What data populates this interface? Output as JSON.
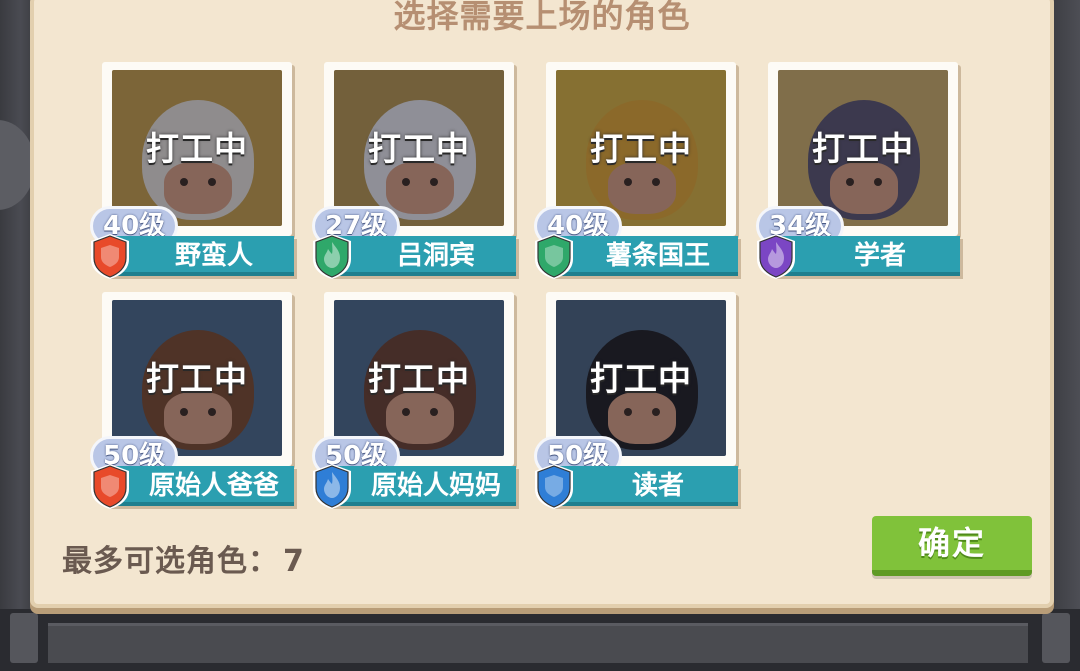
{
  "title": "选择需要上场的角色",
  "status_text": "打工中",
  "characters": [
    {
      "name": "野蛮人",
      "level": "40级",
      "badge_color": "#e84a2a",
      "badge_icon": "shield-icon",
      "bg": "#c9a14a",
      "hair": "#e9e4dc"
    },
    {
      "name": "吕洞宾",
      "level": "27级",
      "badge_color": "#2fa86a",
      "badge_icon": "flame-icon",
      "bg": "#b89850",
      "hair": "#e8e8ee"
    },
    {
      "name": "薯条国王",
      "level": "40级",
      "badge_color": "#2fa86a",
      "badge_icon": "shield-icon",
      "bg": "#d9b341",
      "hair": "#e2a833"
    },
    {
      "name": "学者",
      "level": "34级",
      "badge_color": "#7b46c4",
      "badge_icon": "flame-icon",
      "bg": "#cfb06a",
      "hair": "#5a5570"
    },
    {
      "name": "原始人爸爸",
      "level": "50级",
      "badge_color": "#e84a2a",
      "badge_icon": "shield-icon",
      "bg": "#4a6a8a",
      "hair": "#7a4a2e"
    },
    {
      "name": "原始人妈妈",
      "level": "50级",
      "badge_color": "#2f7ed6",
      "badge_icon": "flame-icon",
      "bg": "#4a6a8a",
      "hair": "#6a4030"
    },
    {
      "name": "读者",
      "level": "50级",
      "badge_color": "#2f7ed6",
      "badge_icon": "shield-icon",
      "bg": "#4a6580",
      "hair": "#1e1e22"
    }
  ],
  "footer": {
    "label": "最多可选角色：",
    "max_count": "7"
  },
  "confirm_label": "确定"
}
